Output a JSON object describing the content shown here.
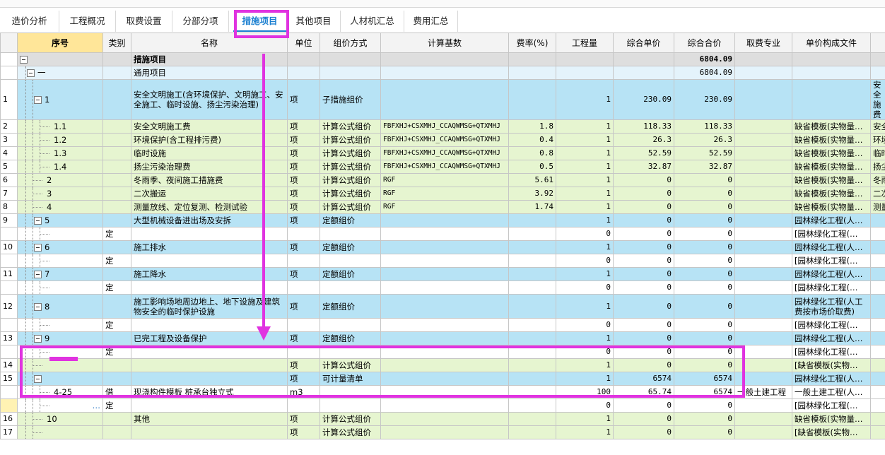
{
  "tabs": [
    {
      "label": "造价分析",
      "active": false
    },
    {
      "label": "工程概况",
      "active": false
    },
    {
      "label": "取费设置",
      "active": false
    },
    {
      "label": "分部分项",
      "active": false
    },
    {
      "label": "措施项目",
      "active": true
    },
    {
      "label": "其他项目",
      "active": false
    },
    {
      "label": "人材机汇总",
      "active": false
    },
    {
      "label": "费用汇总",
      "active": false
    }
  ],
  "columns": [
    "",
    "序号",
    "类别",
    "名称",
    "单位",
    "组价方式",
    "计算基数",
    "费率(%)",
    "工程量",
    "综合单价",
    "综合合价",
    "取费专业",
    "单价构成文件",
    ""
  ],
  "rows": [
    {
      "no": "",
      "seq": "",
      "type": "",
      "name": "措施项目",
      "unit": "",
      "method": "",
      "base": "",
      "rate": "",
      "qty": "",
      "uprice": "",
      "total": "6804.09",
      "spec": "",
      "file": "",
      "extra": ""
    },
    {
      "no": "",
      "seq": "一",
      "type": "",
      "name": "通用项目",
      "unit": "",
      "method": "",
      "base": "",
      "rate": "",
      "qty": "",
      "uprice": "",
      "total": "6804.09",
      "spec": "",
      "file": "",
      "extra": ""
    },
    {
      "no": "1",
      "seq": "1",
      "type": "",
      "name": "安全文明施工(含环境保护、文明施工、安全施工、临时设施、扬尘污染治理)",
      "unit": "项",
      "method": "子措施组价",
      "base": "",
      "rate": "",
      "qty": "1",
      "uprice": "230.09",
      "total": "230.09",
      "spec": "",
      "file": "",
      "extra": "安全施费"
    },
    {
      "no": "2",
      "seq": "1.1",
      "type": "",
      "name": "安全文明施工费",
      "unit": "项",
      "method": "计算公式组价",
      "base": "FBFXHJ+CSXMHJ_CCAQWMSG+QTXMHJ",
      "rate": "1.8",
      "qty": "1",
      "uprice": "118.33",
      "total": "118.33",
      "spec": "",
      "file": "缺省模板(实物量…",
      "extra": "安全"
    },
    {
      "no": "3",
      "seq": "1.2",
      "type": "",
      "name": "环境保护(含工程排污费)",
      "unit": "项",
      "method": "计算公式组价",
      "base": "FBFXHJ+CSXMHJ_CCAQWMSG+QTXMHJ",
      "rate": "0.4",
      "qty": "1",
      "uprice": "26.3",
      "total": "26.3",
      "spec": "",
      "file": "缺省模板(实物量…",
      "extra": "环境"
    },
    {
      "no": "4",
      "seq": "1.3",
      "type": "",
      "name": "临时设施",
      "unit": "项",
      "method": "计算公式组价",
      "base": "FBFXHJ+CSXMHJ_CCAQWMSG+QTXMHJ",
      "rate": "0.8",
      "qty": "1",
      "uprice": "52.59",
      "total": "52.59",
      "spec": "",
      "file": "缺省模板(实物量…",
      "extra": "临时"
    },
    {
      "no": "5",
      "seq": "1.4",
      "type": "",
      "name": "扬尘污染治理费",
      "unit": "项",
      "method": "计算公式组价",
      "base": "FBFXHJ+CSXMHJ_CCAQWMSG+QTXMHJ",
      "rate": "0.5",
      "qty": "1",
      "uprice": "32.87",
      "total": "32.87",
      "spec": "",
      "file": "缺省模板(实物量…",
      "extra": "扬尘"
    },
    {
      "no": "6",
      "seq": "2",
      "type": "",
      "name": "冬雨季、夜间施工措施费",
      "unit": "项",
      "method": "计算公式组价",
      "base": "RGF",
      "rate": "5.61",
      "qty": "1",
      "uprice": "0",
      "total": "0",
      "spec": "",
      "file": "缺省模板(实物量…",
      "extra": "冬雨"
    },
    {
      "no": "7",
      "seq": "3",
      "type": "",
      "name": "二次搬运",
      "unit": "项",
      "method": "计算公式组价",
      "base": "RGF",
      "rate": "3.92",
      "qty": "1",
      "uprice": "0",
      "total": "0",
      "spec": "",
      "file": "缺省模板(实物量…",
      "extra": "二次"
    },
    {
      "no": "8",
      "seq": "4",
      "type": "",
      "name": "测量放线、定位复测、检测试验",
      "unit": "项",
      "method": "计算公式组价",
      "base": "RGF",
      "rate": "1.74",
      "qty": "1",
      "uprice": "0",
      "total": "0",
      "spec": "",
      "file": "缺省模板(实物量…",
      "extra": "测量"
    },
    {
      "no": "9",
      "seq": "5",
      "type": "",
      "name": "大型机械设备进出场及安拆",
      "unit": "项",
      "method": "定额组价",
      "base": "",
      "rate": "",
      "qty": "1",
      "uprice": "0",
      "total": "0",
      "spec": "",
      "file": "园林绿化工程(人…",
      "extra": ""
    },
    {
      "no": "",
      "seq": "",
      "type": "定",
      "name": "",
      "unit": "",
      "method": "",
      "base": "",
      "rate": "",
      "qty": "0",
      "uprice": "0",
      "total": "0",
      "spec": "",
      "file": "[园林绿化工程(…",
      "extra": ""
    },
    {
      "no": "10",
      "seq": "6",
      "type": "",
      "name": "施工排水",
      "unit": "项",
      "method": "定额组价",
      "base": "",
      "rate": "",
      "qty": "1",
      "uprice": "0",
      "total": "0",
      "spec": "",
      "file": "园林绿化工程(人…",
      "extra": ""
    },
    {
      "no": "",
      "seq": "",
      "type": "定",
      "name": "",
      "unit": "",
      "method": "",
      "base": "",
      "rate": "",
      "qty": "0",
      "uprice": "0",
      "total": "0",
      "spec": "",
      "file": "[园林绿化工程(…",
      "extra": ""
    },
    {
      "no": "11",
      "seq": "7",
      "type": "",
      "name": "施工降水",
      "unit": "项",
      "method": "定额组价",
      "base": "",
      "rate": "",
      "qty": "1",
      "uprice": "0",
      "total": "0",
      "spec": "",
      "file": "园林绿化工程(人…",
      "extra": ""
    },
    {
      "no": "",
      "seq": "",
      "type": "定",
      "name": "",
      "unit": "",
      "method": "",
      "base": "",
      "rate": "",
      "qty": "0",
      "uprice": "0",
      "total": "0",
      "spec": "",
      "file": "[园林绿化工程(…",
      "extra": ""
    },
    {
      "no": "12",
      "seq": "8",
      "type": "",
      "name": "施工影响场地周边地上、地下设施及建筑物安全的临时保护设施",
      "unit": "项",
      "method": "定额组价",
      "base": "",
      "rate": "",
      "qty": "1",
      "uprice": "0",
      "total": "0",
      "spec": "",
      "file": "园林绿化工程(人工费按市场价取费)",
      "extra": ""
    },
    {
      "no": "",
      "seq": "",
      "type": "定",
      "name": "",
      "unit": "",
      "method": "",
      "base": "",
      "rate": "",
      "qty": "0",
      "uprice": "0",
      "total": "0",
      "spec": "",
      "file": "[园林绿化工程(…",
      "extra": ""
    },
    {
      "no": "13",
      "seq": "9",
      "type": "",
      "name": "已完工程及设备保护",
      "unit": "项",
      "method": "定额组价",
      "base": "",
      "rate": "",
      "qty": "1",
      "uprice": "0",
      "total": "0",
      "spec": "",
      "file": "园林绿化工程(人…",
      "extra": ""
    },
    {
      "no": "",
      "seq": "",
      "type": "定",
      "name": "",
      "unit": "",
      "method": "",
      "base": "",
      "rate": "",
      "qty": "0",
      "uprice": "0",
      "total": "0",
      "spec": "",
      "file": "[园林绿化工程(…",
      "extra": ""
    },
    {
      "no": "14",
      "seq": "",
      "type": "",
      "name": "",
      "unit": "项",
      "method": "计算公式组价",
      "base": "",
      "rate": "",
      "qty": "1",
      "uprice": "0",
      "total": "0",
      "spec": "",
      "file": "[缺省模板(实物…",
      "extra": ""
    },
    {
      "no": "15",
      "seq": "",
      "type": "",
      "name": "",
      "unit": "项",
      "method": "可计量清单",
      "base": "",
      "rate": "",
      "qty": "1",
      "uprice": "6574",
      "total": "6574",
      "spec": "",
      "file": "园林绿化工程(人…",
      "extra": ""
    },
    {
      "no": "",
      "seq": "4-25",
      "type": "借",
      "name": "现浇构件模板 桩承台独立式",
      "unit": "m3",
      "method": "",
      "base": "",
      "rate": "",
      "qty": "100",
      "uprice": "65.74",
      "total": "6574",
      "spec": "一般土建工程",
      "file": "一般土建工程(人…",
      "extra": ""
    },
    {
      "no": "",
      "seq": "…",
      "type": "定",
      "name": "",
      "unit": "",
      "method": "",
      "base": "",
      "rate": "",
      "qty": "0",
      "uprice": "0",
      "total": "0",
      "spec": "",
      "file": "[园林绿化工程(…",
      "extra": ""
    },
    {
      "no": "16",
      "seq": "10",
      "type": "",
      "name": "其他",
      "unit": "项",
      "method": "计算公式组价",
      "base": "",
      "rate": "",
      "qty": "1",
      "uprice": "0",
      "total": "0",
      "spec": "",
      "file": "缺省模板(实物量…",
      "extra": ""
    },
    {
      "no": "17",
      "seq": "",
      "type": "",
      "name": "",
      "unit": "项",
      "method": "计算公式组价",
      "base": "",
      "rate": "",
      "qty": "1",
      "uprice": "0",
      "total": "0",
      "spec": "",
      "file": "[缺省模板(实物…",
      "extra": ""
    }
  ]
}
